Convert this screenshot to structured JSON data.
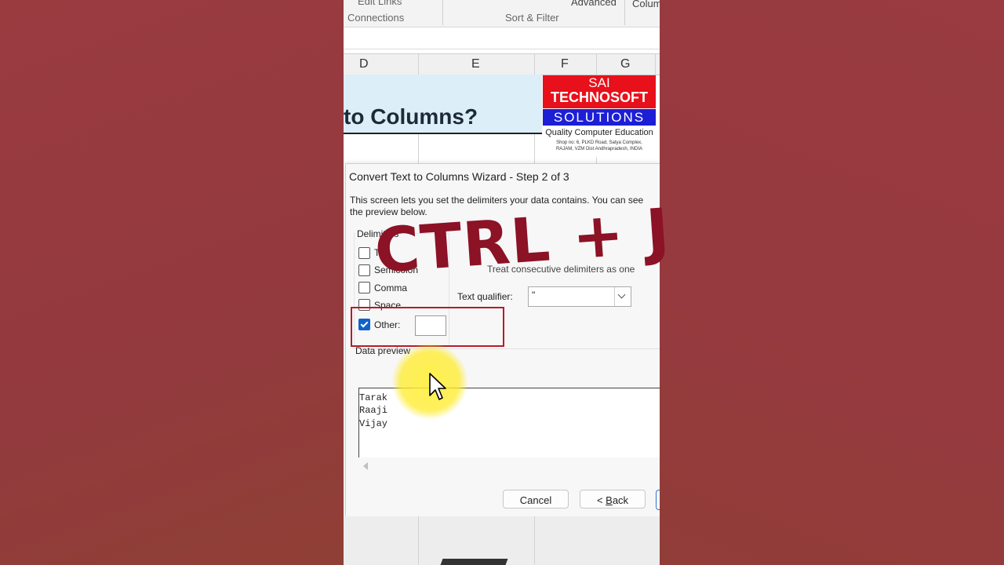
{
  "ribbon": {
    "edit_links": "Edit Links",
    "advanced": "Advanced",
    "columns_partial": "Colum",
    "group_connections": "Connections",
    "group_sort_filter": "Sort & Filter"
  },
  "columns": [
    "D",
    "E",
    "F",
    "G"
  ],
  "sheet": {
    "heading": "to Columns?"
  },
  "logo": {
    "line1": "SAI",
    "line2": "TECHNOSOFT",
    "line3": "SOLUTIONS",
    "tagline": "Quality Computer Education",
    "address1": "Shop no: 6, PLKD Road, Satya Complex,",
    "address2": "RAJAM,   VZM Dist   Andhrapradesh, INDIA"
  },
  "dialog": {
    "title": "Convert Text to Columns Wizard - Step 2 of 3",
    "description_line1": "This screen lets you set the delimiters your data contains.  You can see",
    "description_line2": "the preview below.",
    "delimiters_label": "Delimiters",
    "options": {
      "tab": {
        "label": "Tab",
        "checked": false
      },
      "semicolon": {
        "label": "Semicolon",
        "checked": false
      },
      "comma": {
        "label": "Comma",
        "checked": false
      },
      "space": {
        "label": "Space",
        "checked": false
      },
      "other": {
        "label": "Other:",
        "checked": true,
        "value": ""
      }
    },
    "consecutive_label": "Treat consecutive delimiters as one",
    "text_qualifier_label": "Text qualifier:",
    "text_qualifier_value": "\"",
    "data_preview_label": "Data preview",
    "preview_rows": [
      "Tarak",
      "Raaji",
      "Vijay"
    ],
    "buttons": {
      "cancel": "Cancel",
      "back_prefix": "< ",
      "back_underline": "B",
      "back_rest": "ack"
    }
  },
  "overlay_text": "CTRL + J",
  "colors": {
    "accent_checkbox": "#0f62c9",
    "highlight_border": "#b51c2a",
    "overlay_text": "#8c1226",
    "background": "#97393d"
  }
}
